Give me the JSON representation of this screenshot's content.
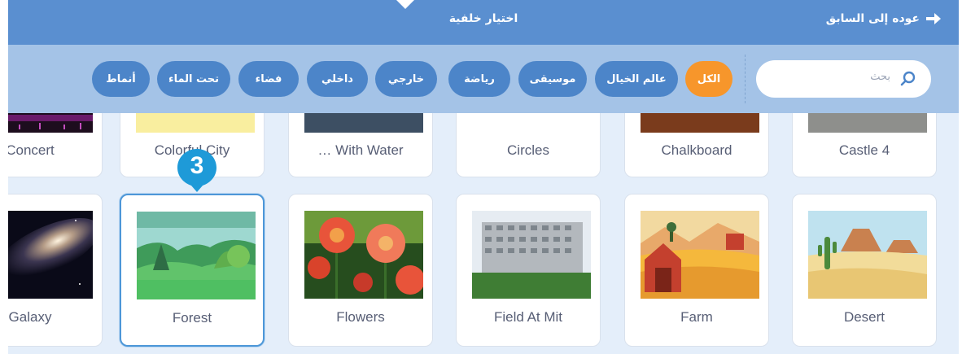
{
  "header": {
    "back_label": "عوده إلى السابق",
    "title": "اختيار خلفية"
  },
  "search": {
    "placeholder": "بحث"
  },
  "categories": [
    "الكل",
    "عالم الخيال",
    "موسيقى",
    "رياضة",
    "خارجي",
    "داخلي",
    "فضاء",
    "تحت الماء",
    "أنماط"
  ],
  "active_category": "الكل",
  "row1": [
    "Concert",
    "Colorful City",
    "… With Water",
    "Circles",
    "Chalkboard",
    "Castle 4"
  ],
  "row2": [
    "Galaxy",
    "Forest",
    "Flowers",
    "Field At Mit",
    "Farm",
    "Desert"
  ],
  "selected": "Forest",
  "callout": {
    "number": "3"
  },
  "colors": {
    "header": "#5a8fd0",
    "filter_bar": "#a4c3e7",
    "pill": "#4c85c9",
    "pill_active": "#f7962b",
    "badge": "#1e9ad8"
  }
}
